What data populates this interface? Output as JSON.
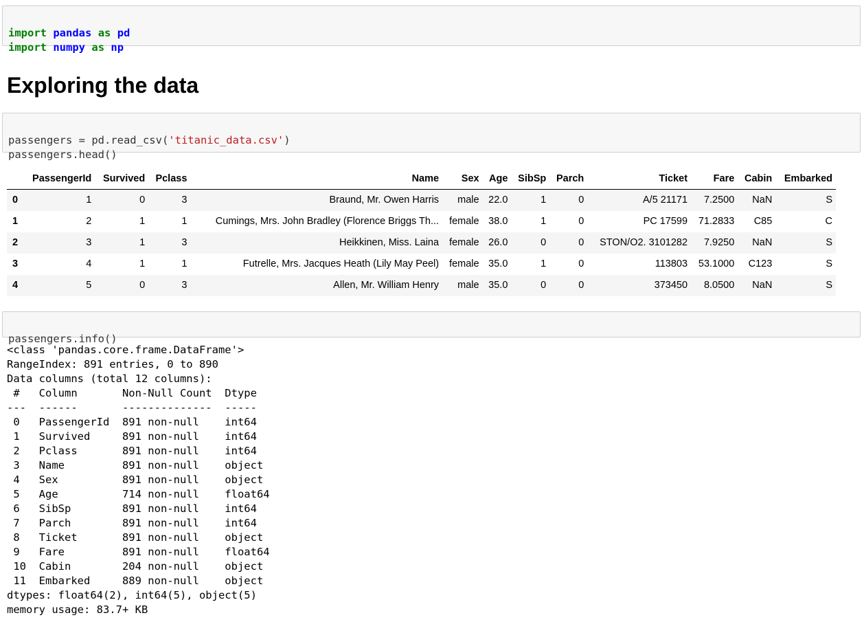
{
  "cell1": {
    "line1": {
      "kw1": "import",
      "mod1": "pandas",
      "kw2": "as",
      "mod2": "pd"
    },
    "line2": {
      "kw1": "import",
      "mod1": "numpy",
      "kw2": "as",
      "mod2": "np"
    }
  },
  "heading": "Exploring the data",
  "cell2": {
    "line1_prefix": "passengers = pd.read_csv(",
    "line1_string": "'titanic_data.csv'",
    "line1_suffix": ")",
    "line2": "passengers.head()"
  },
  "table": {
    "index_header": "",
    "columns": [
      "PassengerId",
      "Survived",
      "Pclass",
      "Name",
      "Sex",
      "Age",
      "SibSp",
      "Parch",
      "Ticket",
      "Fare",
      "Cabin",
      "Embarked"
    ],
    "rows": [
      {
        "index": "0",
        "cells": [
          "1",
          "0",
          "3",
          "Braund, Mr. Owen Harris",
          "male",
          "22.0",
          "1",
          "0",
          "A/5 21171",
          "7.2500",
          "NaN",
          "S"
        ]
      },
      {
        "index": "1",
        "cells": [
          "2",
          "1",
          "1",
          "Cumings, Mrs. John Bradley (Florence Briggs Th...",
          "female",
          "38.0",
          "1",
          "0",
          "PC 17599",
          "71.2833",
          "C85",
          "C"
        ]
      },
      {
        "index": "2",
        "cells": [
          "3",
          "1",
          "3",
          "Heikkinen, Miss. Laina",
          "female",
          "26.0",
          "0",
          "0",
          "STON/O2. 3101282",
          "7.9250",
          "NaN",
          "S"
        ]
      },
      {
        "index": "3",
        "cells": [
          "4",
          "1",
          "1",
          "Futrelle, Mrs. Jacques Heath (Lily May Peel)",
          "female",
          "35.0",
          "1",
          "0",
          "113803",
          "53.1000",
          "C123",
          "S"
        ]
      },
      {
        "index": "4",
        "cells": [
          "5",
          "0",
          "3",
          "Allen, Mr. William Henry",
          "male",
          "35.0",
          "0",
          "0",
          "373450",
          "8.0500",
          "NaN",
          "S"
        ]
      }
    ]
  },
  "cell3": {
    "code": "passengers.info()"
  },
  "info_output": {
    "lines": [
      "<class 'pandas.core.frame.DataFrame'>",
      "RangeIndex: 891 entries, 0 to 890",
      "Data columns (total 12 columns):",
      " #   Column       Non-Null Count  Dtype  ",
      "---  ------       --------------  -----  ",
      " 0   PassengerId  891 non-null    int64  ",
      " 1   Survived     891 non-null    int64  ",
      " 2   Pclass       891 non-null    int64  ",
      " 3   Name         891 non-null    object ",
      " 4   Sex          891 non-null    object ",
      " 5   Age          714 non-null    float64",
      " 6   SibSp        891 non-null    int64  ",
      " 7   Parch        891 non-null    int64  ",
      " 8   Ticket       891 non-null    object ",
      " 9   Fare         891 non-null    float64",
      " 10  Cabin        204 non-null    object ",
      " 11  Embarked     889 non-null    object ",
      "dtypes: float64(2), int64(5), object(5)",
      "memory usage: 83.7+ KB"
    ]
  }
}
